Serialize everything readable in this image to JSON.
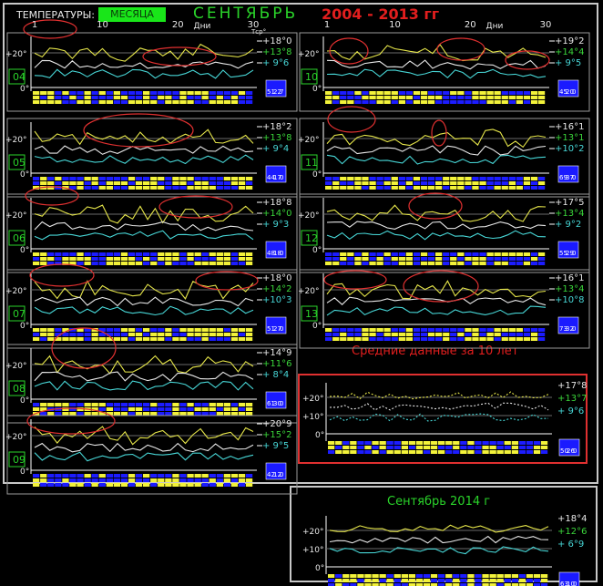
{
  "header": {
    "temps_label": "ТЕМПЕРАТУРЫ:",
    "month_button": "МЕСЯЦА",
    "month_name": "СЕНТЯБРЬ",
    "years": "2004  -  2013 гг"
  },
  "avg_title": "Средние  данные  за  10 лет",
  "bottom_title": "Сентябрь  2014 г",
  "colors": {
    "max_line": "#e6e64a",
    "mean_line": "#e8e8e8",
    "min_line": "#47d6d6",
    "bar_yellow": "#f2f23a",
    "bar_blue": "#1c1cff",
    "max_text": "#e6e6e6",
    "mean_text": "#3ad43a",
    "min_text": "#47d6d6",
    "highlight_ellipse": "#e03030",
    "frame": "#c8c8c8"
  },
  "chart_data": [
    {
      "type": "line",
      "panel": "04",
      "max_label": "+18°0",
      "mean_label": "+13°8",
      "min_label": "+ 9°6",
      "ytick_top": "+20°",
      "ytick_bottom": "0°",
      "xticks": [
        "1",
        "10",
        "20",
        "30"
      ],
      "xlabel": "Дни",
      "ylabel": "Тср°",
      "highlights": [
        "days 1-5",
        "days 19-27"
      ],
      "counts": [
        "51",
        "22",
        "7"
      ]
    },
    {
      "type": "line",
      "panel": "05",
      "max_label": "+18°2",
      "mean_label": "+13°8",
      "min_label": "+ 9°4",
      "ytick_top": "+20°",
      "ytick_bottom": "0°",
      "highlights": [
        "days 10-22"
      ],
      "counts": [
        "44",
        "17",
        "0"
      ]
    },
    {
      "type": "line",
      "panel": "06",
      "max_label": "+18°8",
      "mean_label": "+14°0",
      "min_label": "+ 9°3",
      "ytick_top": "+20°",
      "ytick_bottom": "0°",
      "highlights": [
        "days 1-5",
        "days 19-27"
      ],
      "counts": [
        "48",
        "18",
        "0"
      ]
    },
    {
      "type": "line",
      "panel": "07",
      "max_label": "+18°0",
      "mean_label": "+14°2",
      "min_label": "+10°3",
      "ytick_top": "+20°",
      "ytick_bottom": "0°",
      "highlights": [
        "days 1-10",
        "days 22-30"
      ],
      "counts": [
        "51",
        "27",
        "0"
      ]
    },
    {
      "type": "line",
      "panel": "08",
      "max_label": "+14°9",
      "mean_label": "+11°6",
      "min_label": "+ 8°4",
      "ytick_top": "+20°",
      "ytick_bottom": "0°",
      "highlights": [
        "days 3-10"
      ],
      "counts": [
        "61",
        "30",
        "0"
      ]
    },
    {
      "type": "line",
      "panel": "09",
      "max_label": "+20°9",
      "mean_label": "+15°2",
      "min_label": "+ 9°5",
      "ytick_top": "+20°",
      "ytick_bottom": "0°",
      "highlights": [
        "days 1-10"
      ],
      "counts": [
        "42",
        "12",
        "0"
      ]
    },
    {
      "type": "line",
      "panel": "10",
      "max_label": "+19°2",
      "mean_label": "+14°4",
      "min_label": "+ 9°5",
      "ytick_top": "+20°",
      "ytick_bottom": "0°",
      "xticks": [
        "1",
        "10",
        "20",
        "30"
      ],
      "xlabel": "Дни",
      "highlights": [
        "days 1-5",
        "days 15-22",
        "days 26-31"
      ],
      "counts": [
        "45",
        "20",
        "0"
      ]
    },
    {
      "type": "line",
      "panel": "11",
      "max_label": "+16°1",
      "mean_label": "+13°1",
      "min_label": "+10°2",
      "ytick_top": "+20°",
      "ytick_bottom": "0°",
      "highlights": [
        "days 1-6",
        "days 14-16"
      ],
      "counts": [
        "69",
        "37",
        "0"
      ]
    },
    {
      "type": "line",
      "panel": "12",
      "max_label": "+17°5",
      "mean_label": "+13°4",
      "min_label": "+ 9°2",
      "ytick_top": "+20°",
      "ytick_bottom": "0°",
      "highlights": [
        "days 11-18"
      ],
      "counts": [
        "55",
        "29",
        "0"
      ]
    },
    {
      "type": "line",
      "panel": "13",
      "max_label": "+16°1",
      "mean_label": "+13°4",
      "min_label": "+10°8",
      "ytick_top": "+20°",
      "ytick_bottom": "0°",
      "highlights": [
        "days 1-8",
        "days 11-22"
      ],
      "counts": [
        "73",
        "32",
        "0"
      ]
    },
    {
      "type": "line",
      "panel": "avg",
      "max_label": "+17°8",
      "mean_label": "+13°7",
      "min_label": "+ 9°6",
      "ytick_top": "+20°",
      "ytick_mid": "+10°",
      "ytick_bottom": "0°",
      "counts": [
        "50",
        "26",
        "0"
      ]
    },
    {
      "type": "line",
      "panel": "2014",
      "max_label": "+18°4",
      "mean_label": "+12°6",
      "min_label": "+ 6°9",
      "ytick_top": "+20°",
      "ytick_mid": "+10°",
      "ytick_bottom": "0°",
      "counts": [
        "63",
        "10",
        "0"
      ]
    }
  ]
}
